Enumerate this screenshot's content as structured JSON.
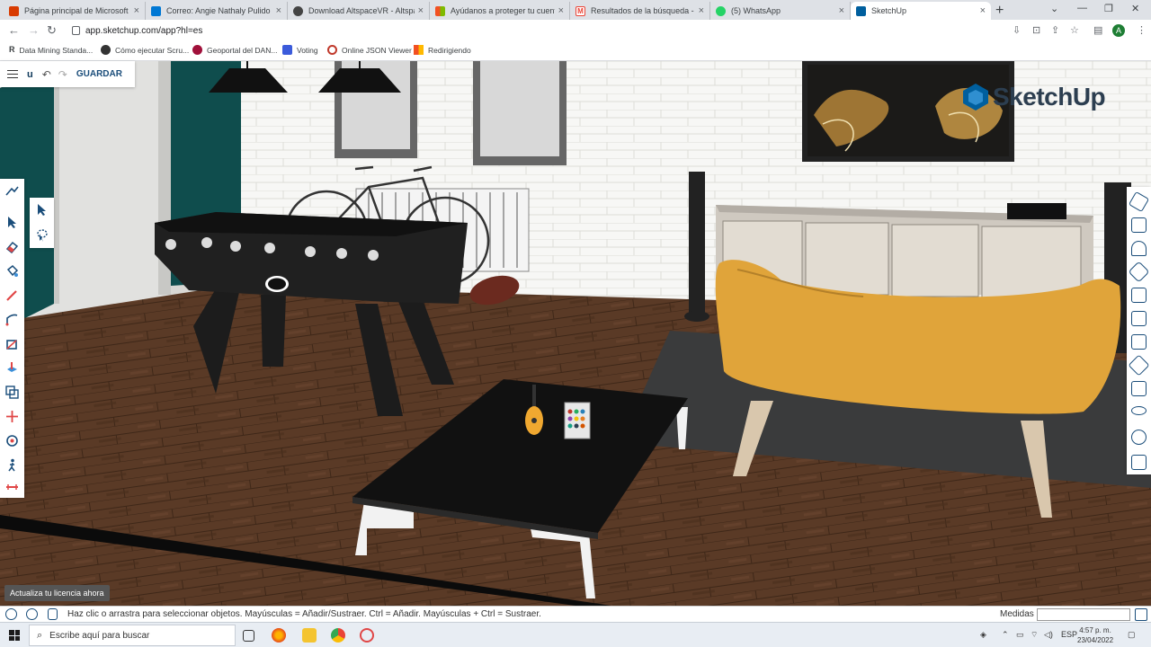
{
  "browser": {
    "tabs": [
      {
        "title": "Página principal de Microsoft Of",
        "favicon_color": "#d83b01"
      },
      {
        "title": "Correo: Angie Nathaly Pulido Ga",
        "favicon_color": "#0078d4"
      },
      {
        "title": "Download AltspaceVR - Altspac",
        "favicon_color": "#444444"
      },
      {
        "title": "Ayúdanos a proteger tu cuenta",
        "favicon_color": "#f25022"
      },
      {
        "title": "Resultados de la búsqueda - u",
        "favicon_color": "#ea4335"
      },
      {
        "title": "(5) WhatsApp",
        "favicon_color": "#25d366"
      },
      {
        "title": "SketchUp",
        "favicon_color": "#005f9e"
      }
    ],
    "new_tab": "+",
    "url": "app.sketchup.com/app?hl=es",
    "profile_initial": "A",
    "bookmarks": [
      {
        "label": "Data Mining Standa...",
        "color": "#555555"
      },
      {
        "label": "Cómo ejecutar Scru...",
        "color": "#333333"
      },
      {
        "label": "Geoportal del DAN...",
        "color": "#a0103a"
      },
      {
        "label": "Voting",
        "color": "#3b5bdb"
      },
      {
        "label": "Online JSON Viewer",
        "color": "#c0392b"
      },
      {
        "label": "Redirigiendo",
        "color": "#f4b400"
      }
    ]
  },
  "sketchup": {
    "topbar": {
      "user_initial": "u",
      "save_label": "GUARDAR"
    },
    "logo_text": "SketchUp",
    "license_label": "Actualiza tu licencia ahora",
    "tools": [
      "walk-icon",
      "select-icon",
      "eraser-icon",
      "paint-bucket-icon",
      "pencil-icon",
      "arc-icon",
      "shape-icon",
      "push-pull-icon",
      "offset-icon",
      "move-icon",
      "rotate-icon",
      "walk-person-icon",
      "tape-measure-icon"
    ],
    "subtools": [
      "select-arrow-icon",
      "lasso-icon"
    ],
    "right_panel": [
      "entity-info-icon",
      "instructor-icon",
      "materials-icon",
      "components-icon",
      "styles-icon",
      "tags-icon",
      "scenes-icon",
      "shadows-icon",
      "display-icon",
      "solid-icon",
      "glasses-icon",
      "info-icon",
      "outliner-icon"
    ],
    "status": {
      "hint": "Haz clic o arrastra para seleccionar objetos. Mayúsculas = Añadir/Sustraer. Ctrl = Añadir. Mayúsculas + Ctrl = Sustraer.",
      "measure_label": "Medidas",
      "measure_value": ""
    }
  },
  "taskbar": {
    "search_placeholder": "Escribe aquí para buscar",
    "language": "ESP",
    "time": "4:57 p. m.",
    "date": "23/04/2022"
  },
  "colors": {
    "sketchup_blue": "#1a4d7a",
    "sofa": "#e0a43a",
    "floor": "#5a3a26",
    "wall_teal": "#0f4d4d"
  }
}
